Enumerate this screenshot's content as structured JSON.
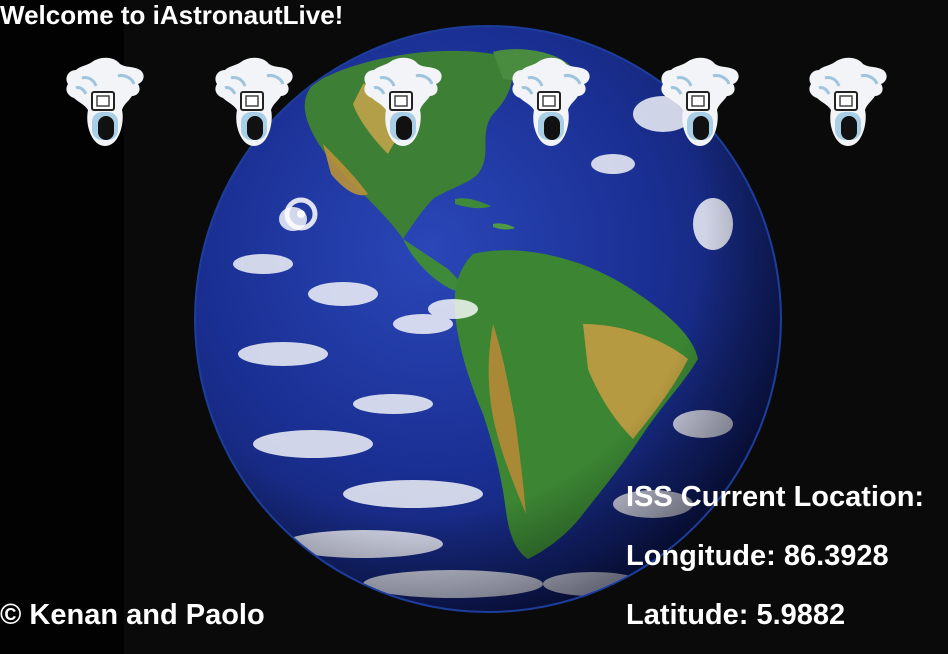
{
  "header": {
    "title": "Welcome to iAstronautLive!"
  },
  "background": {
    "image": "earth-globe-americas"
  },
  "astronauts": {
    "icon": "astronaut-icon",
    "count": 6
  },
  "iss": {
    "heading": "ISS Current Location:",
    "longitude_text": "Longitude: 86.3928",
    "latitude_text": "Latitude: 5.9882"
  },
  "footer": {
    "credit": "© Kenan and Paolo"
  },
  "colors": {
    "text": "#ffffff",
    "background": "#0a0a0a",
    "ocean": "#1c2f8a",
    "land": "#3f8a3a",
    "desert": "#c9a244"
  }
}
